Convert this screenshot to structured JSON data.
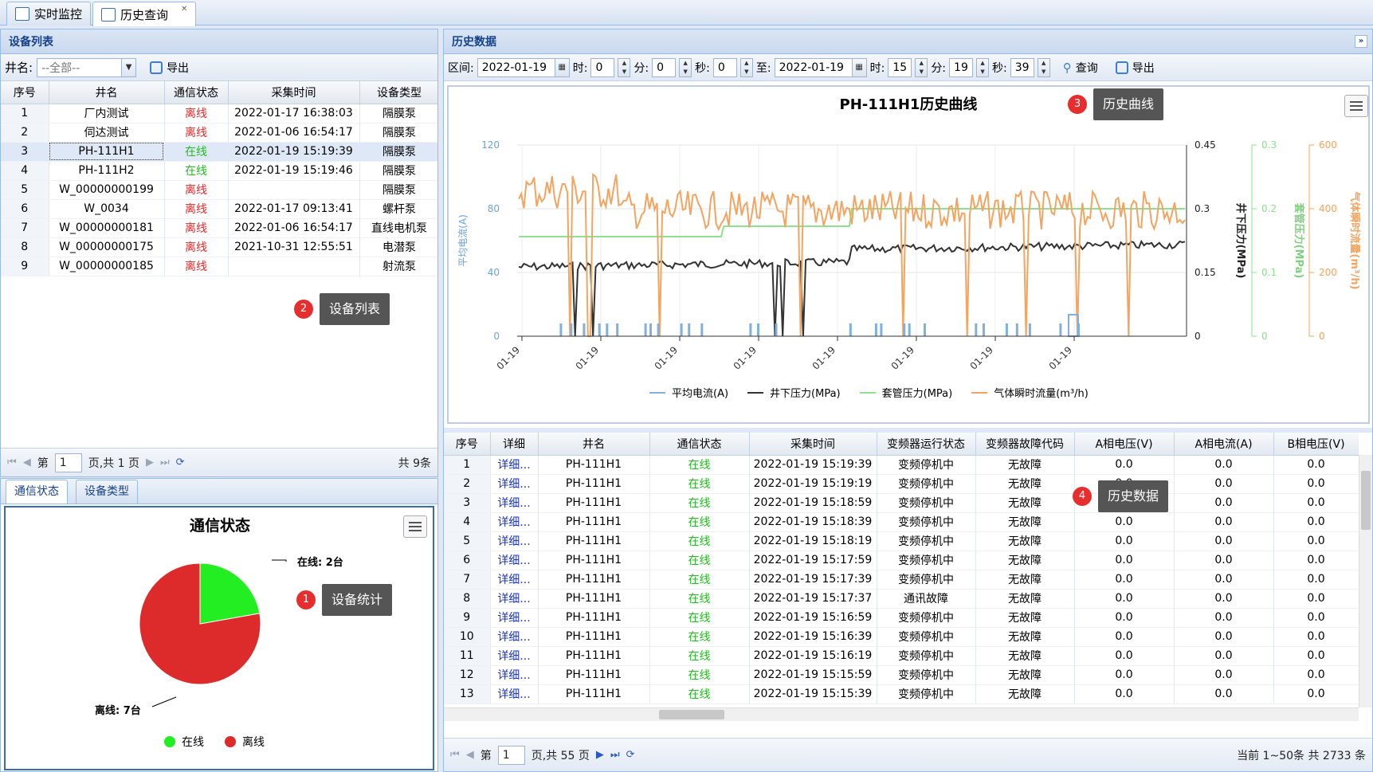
{
  "tabs": [
    {
      "label": "实时监控"
    },
    {
      "label": "历史查询"
    }
  ],
  "left": {
    "title": "设备列表",
    "filter_label": "井名:",
    "filter_value": "--全部--",
    "export_label": "导出",
    "columns": [
      "序号",
      "井名",
      "通信状态",
      "采集时间",
      "设备类型"
    ],
    "rows": [
      {
        "idx": "1",
        "name": "厂内测试",
        "status": "离线",
        "time": "2022-01-17 16:38:03",
        "type": "隔膜泵"
      },
      {
        "idx": "2",
        "name": "伺达测试",
        "status": "离线",
        "time": "2022-01-06 16:54:17",
        "type": "隔膜泵"
      },
      {
        "idx": "3",
        "name": "PH-111H1",
        "status": "在线",
        "time": "2022-01-19 15:19:39",
        "type": "隔膜泵"
      },
      {
        "idx": "4",
        "name": "PH-111H2",
        "status": "在线",
        "time": "2022-01-19 15:19:46",
        "type": "隔膜泵"
      },
      {
        "idx": "5",
        "name": "W_00000000199",
        "status": "离线",
        "time": "",
        "type": "隔膜泵"
      },
      {
        "idx": "6",
        "name": "W_0034",
        "status": "离线",
        "time": "2022-01-17 09:13:41",
        "type": "螺杆泵"
      },
      {
        "idx": "7",
        "name": "W_00000000181",
        "status": "离线",
        "time": "2022-01-06 16:54:17",
        "type": "直线电机泵"
      },
      {
        "idx": "8",
        "name": "W_00000000175",
        "status": "离线",
        "time": "2021-10-31 12:55:51",
        "type": "电潜泵"
      },
      {
        "idx": "9",
        "name": "W_00000000185",
        "status": "离线",
        "time": "",
        "type": "射流泵"
      }
    ],
    "selected_row": "3",
    "pager": {
      "page_prefix": "第",
      "page": "1",
      "page_suffix": "页,共 1 页",
      "total": "共 9条"
    }
  },
  "stats": {
    "tabs": [
      "通信状态",
      "设备类型"
    ],
    "title": "通信状态",
    "online_label": "在线: 2台",
    "offline_label": "离线: 7台",
    "legend": [
      "在线",
      "离线"
    ],
    "colors": {
      "online": "#22ee22",
      "offline": "#dd2b2b"
    },
    "online": 2,
    "offline": 7
  },
  "history": {
    "title": "历史数据",
    "toolbar": {
      "range_label": "区间:",
      "date_from": "2022-01-19",
      "h_label": "时:",
      "h_from": "0",
      "m_label": "分:",
      "m_from": "0",
      "s_label": "秒:",
      "s_from": "0",
      "to_label": "至:",
      "date_to": "2022-01-19",
      "h_to": "15",
      "m_to": "19",
      "s_to": "39",
      "query_label": "查询",
      "export_label": "导出"
    },
    "chart_title": "PH-111H1历史曲线",
    "axes": {
      "y1_label": "平均电流(A)",
      "y1_ticks": [
        "120",
        "80",
        "40",
        "0"
      ],
      "y2_label": "井下压力(MPa)",
      "y2_ticks": [
        "0.45",
        "0.3",
        "0.15",
        "0"
      ],
      "y3_label": "套管压力(MPa)",
      "y3_ticks": [
        "0.3",
        "0.2",
        "0.1",
        "0"
      ],
      "y4_label": "气体瞬时流量(m³/h)",
      "y4_ticks": [
        "600",
        "400",
        "200",
        "0"
      ],
      "x_ticks": [
        "01-19",
        "01-19",
        "01-19",
        "01-19",
        "01-19",
        "01-19",
        "01-19",
        "01-19"
      ]
    },
    "legend": [
      {
        "name": "平均电流(A)",
        "color": "#7fb0e0"
      },
      {
        "name": "井下压力(MPa)",
        "color": "#333333"
      },
      {
        "name": "套管压力(MPa)",
        "color": "#8fe08f"
      },
      {
        "name": "气体瞬时流量(m³/h)",
        "color": "#f4a460"
      }
    ],
    "columns": [
      "序号",
      "详细",
      "井名",
      "通信状态",
      "采集时间",
      "变频器运行状态",
      "变频器故障代码",
      "A相电压(V)",
      "A相电流(A)",
      "B相电压(V)"
    ],
    "rows": [
      {
        "idx": "1",
        "detail": "详细...",
        "name": "PH-111H1",
        "status": "在线",
        "time": "2022-01-19 15:19:39",
        "run": "变频停机中",
        "fault": "无故障",
        "av": "0.0",
        "ai": "0.0",
        "bv": "0.0"
      },
      {
        "idx": "2",
        "detail": "详细...",
        "name": "PH-111H1",
        "status": "在线",
        "time": "2022-01-19 15:19:19",
        "run": "变频停机中",
        "fault": "无故障",
        "av": "0.0",
        "ai": "0.0",
        "bv": "0.0"
      },
      {
        "idx": "3",
        "detail": "详细...",
        "name": "PH-111H1",
        "status": "在线",
        "time": "2022-01-19 15:18:59",
        "run": "变频停机中",
        "fault": "无故障",
        "av": "0.0",
        "ai": "0.0",
        "bv": "0.0"
      },
      {
        "idx": "4",
        "detail": "详细...",
        "name": "PH-111H1",
        "status": "在线",
        "time": "2022-01-19 15:18:39",
        "run": "变频停机中",
        "fault": "无故障",
        "av": "0.0",
        "ai": "0.0",
        "bv": "0.0"
      },
      {
        "idx": "5",
        "detail": "详细...",
        "name": "PH-111H1",
        "status": "在线",
        "time": "2022-01-19 15:18:19",
        "run": "变频停机中",
        "fault": "无故障",
        "av": "0.0",
        "ai": "0.0",
        "bv": "0.0"
      },
      {
        "idx": "6",
        "detail": "详细...",
        "name": "PH-111H1",
        "status": "在线",
        "time": "2022-01-19 15:17:59",
        "run": "变频停机中",
        "fault": "无故障",
        "av": "0.0",
        "ai": "0.0",
        "bv": "0.0"
      },
      {
        "idx": "7",
        "detail": "详细...",
        "name": "PH-111H1",
        "status": "在线",
        "time": "2022-01-19 15:17:39",
        "run": "变频停机中",
        "fault": "无故障",
        "av": "0.0",
        "ai": "0.0",
        "bv": "0.0"
      },
      {
        "idx": "8",
        "detail": "详细...",
        "name": "PH-111H1",
        "status": "在线",
        "time": "2022-01-19 15:17:37",
        "run": "通讯故障",
        "fault": "无故障",
        "av": "0.0",
        "ai": "0.0",
        "bv": "0.0"
      },
      {
        "idx": "9",
        "detail": "详细...",
        "name": "PH-111H1",
        "status": "在线",
        "time": "2022-01-19 15:16:59",
        "run": "变频停机中",
        "fault": "无故障",
        "av": "0.0",
        "ai": "0.0",
        "bv": "0.0"
      },
      {
        "idx": "10",
        "detail": "详细...",
        "name": "PH-111H1",
        "status": "在线",
        "time": "2022-01-19 15:16:39",
        "run": "变频停机中",
        "fault": "无故障",
        "av": "0.0",
        "ai": "0.0",
        "bv": "0.0"
      },
      {
        "idx": "11",
        "detail": "详细...",
        "name": "PH-111H1",
        "status": "在线",
        "time": "2022-01-19 15:16:19",
        "run": "变频停机中",
        "fault": "无故障",
        "av": "0.0",
        "ai": "0.0",
        "bv": "0.0"
      },
      {
        "idx": "12",
        "detail": "详细...",
        "name": "PH-111H1",
        "status": "在线",
        "time": "2022-01-19 15:15:59",
        "run": "变频停机中",
        "fault": "无故障",
        "av": "0.0",
        "ai": "0.0",
        "bv": "0.0"
      },
      {
        "idx": "13",
        "detail": "详细...",
        "name": "PH-111H1",
        "status": "在线",
        "time": "2022-01-19 15:15:39",
        "run": "变频停机中",
        "fault": "无故障",
        "av": "0.0",
        "ai": "0.0",
        "bv": "0.0"
      }
    ],
    "pager": {
      "page_prefix": "第",
      "page": "1",
      "page_suffix": "页,共 55 页",
      "total": "当前 1~50条 共 2733 条"
    }
  },
  "callouts": [
    {
      "num": "1",
      "label": "设备统计"
    },
    {
      "num": "2",
      "label": "设备列表"
    },
    {
      "num": "3",
      "label": "历史曲线"
    },
    {
      "num": "4",
      "label": "历史数据"
    }
  ]
}
